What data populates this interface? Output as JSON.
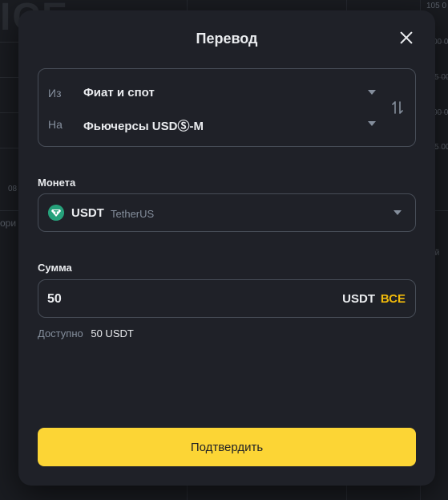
{
  "background": {
    "logo_text": "ICE",
    "price_labels": [
      "105 0",
      "00 0",
      "5 00",
      "00 0",
      "5 00"
    ],
    "time_label": "08",
    "tab_text": "ори",
    "side_text": "ий"
  },
  "modal": {
    "title": "Перевод",
    "wallet": {
      "from_prefix": "Из",
      "from_value": "Фиат и спот",
      "to_prefix": "На",
      "to_value": "Фьючерсы USDⓈ-M"
    },
    "coin": {
      "label": "Монета",
      "symbol": "USDT",
      "name": "TetherUS"
    },
    "amount": {
      "label": "Сумма",
      "value": "50",
      "unit": "USDT",
      "max_label": "ВСЕ"
    },
    "available": {
      "label": "Доступно",
      "value": "50 USDT"
    },
    "confirm_label": "Подтвердить"
  },
  "colors": {
    "accent": "#fcd535",
    "accent_text": "#f0b90b",
    "tether": "#26a17b"
  },
  "icons": [
    "close-icon",
    "caret-down-icon",
    "swap-icon",
    "tether-icon"
  ]
}
